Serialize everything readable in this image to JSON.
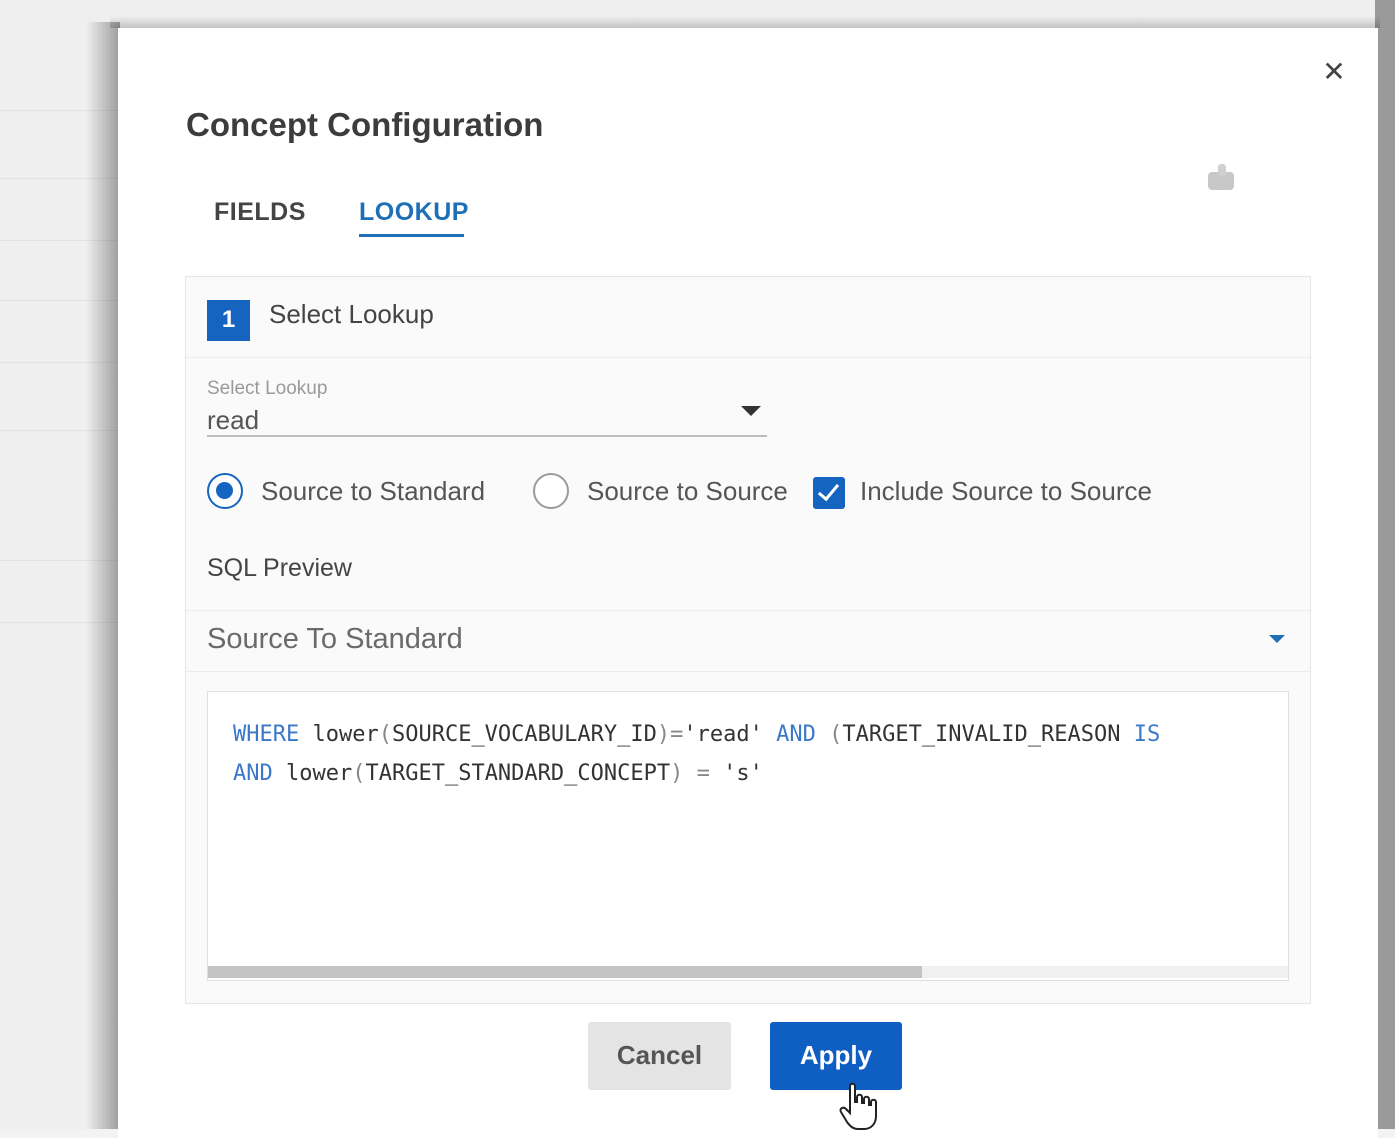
{
  "dialog": {
    "title": "Concept Configuration",
    "close_icon": "close-icon"
  },
  "tabs": [
    {
      "label": "FIELDS",
      "active": false
    },
    {
      "label": "LOOKUP",
      "active": true
    }
  ],
  "step": {
    "number": "1",
    "title": "Select Lookup"
  },
  "lookup_select": {
    "label": "Select Lookup",
    "value": "read"
  },
  "options": {
    "source_to_standard": {
      "label": "Source to Standard",
      "checked": true
    },
    "source_to_source": {
      "label": "Source to Source",
      "checked": false
    },
    "include_source_to_source": {
      "label": "Include Source to Source",
      "checked": true
    }
  },
  "sql_preview": {
    "heading": "SQL Preview",
    "selected": "Source To Standard",
    "line1": {
      "kw1": "WHERE",
      "t1": " lower",
      "p1": "(",
      "t2": "SOURCE_VOCABULARY_ID",
      "p2": ")=",
      "s1": "'read'",
      "kw2": " AND",
      "p3": " (",
      "t3": "TARGET_INVALID_REASON",
      "kw3": " IS"
    },
    "line2": {
      "kw1": "AND",
      "t1": " lower",
      "p1": "(",
      "t2": "TARGET_STANDARD_CONCEPT",
      "p2": ") = ",
      "s1": "'s'"
    }
  },
  "buttons": {
    "cancel": "Cancel",
    "apply": "Apply"
  },
  "colors": {
    "accent": "#1565c0",
    "apply_bg": "#0f5fc2",
    "tab_active": "#1f6fb7",
    "sql_keyword": "#3b78c9"
  }
}
